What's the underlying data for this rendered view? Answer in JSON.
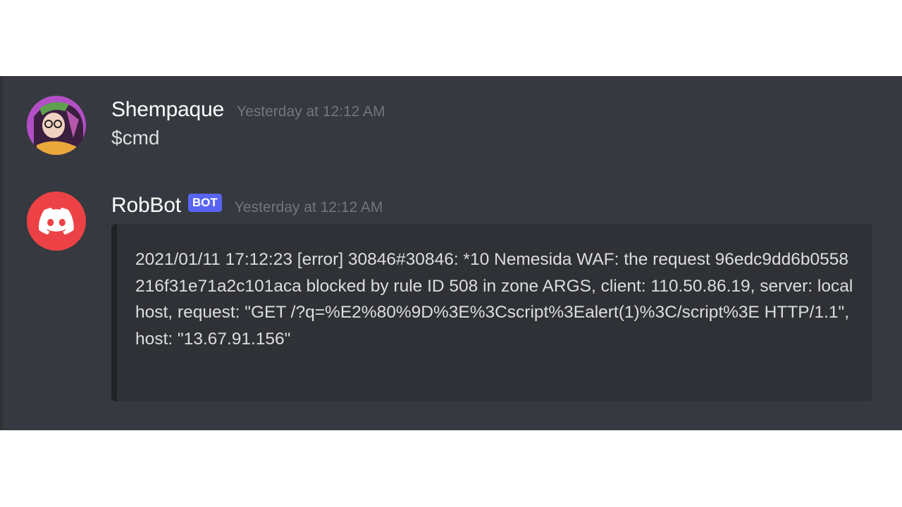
{
  "messages": [
    {
      "author": "Shempaque",
      "timestamp": "Yesterday at 12:12 AM",
      "content": "$cmd",
      "avatar_icon": "user-avatar"
    },
    {
      "author": "RobBot",
      "bot_tag": "BOT",
      "timestamp": "Yesterday at 12:12 AM",
      "avatar_icon": "discord-logo-icon",
      "embed": {
        "text": "2021/01/11 17:12:23 [error] 30846#30846: *10 Nemesida WAF: the request 96edc9dd6b0558216f31e71a2c101aca blocked by rule ID 508 in zone ARGS, client: 110.50.86.19, server: localhost, request: \"GET /?q=%E2%80%9D%3E%3Cscript%3Ealert(1)%3C/script%3E HTTP/1.1\", host: \"13.67.91.156\""
      }
    }
  ],
  "colors": {
    "background": "#36393f",
    "embed_background": "#2f3136",
    "bot_tag": "#5865f2",
    "bot_avatar": "#ed4245",
    "timestamp": "#72767d",
    "text": "#dcddde"
  }
}
